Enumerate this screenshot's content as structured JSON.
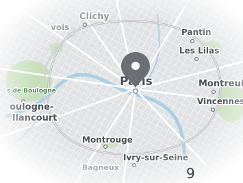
{
  "map": {
    "places": {
      "clichy": "Clichy",
      "pantin": "Pantin",
      "les_lilas": "Les Lilas",
      "paris": "Paris",
      "montreuil": "Montreuil",
      "vincennes": "Vincennes",
      "bois_de_boulogne": "s de Boulogne",
      "boulogne_billancourt_1": "oulogne-",
      "boulogne_billancourt_2": "llancourt",
      "montrouge": "Montrouge",
      "ivry_sur_seine": "Ivry-sur-Seine",
      "bagneux": "Bagneux",
      "levallois_fragment": "vois"
    },
    "marker": {
      "icon": "map-pin-icon",
      "color": "#6b6e72"
    },
    "colors": {
      "roads": "#ffffff",
      "ring_road": "#b9bcc0",
      "water": "#a9cfe6",
      "parks": "#c4dfb4"
    }
  },
  "page_number": "9"
}
